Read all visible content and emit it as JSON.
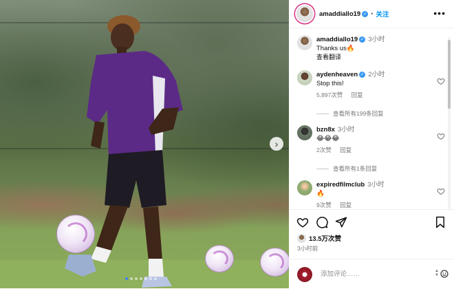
{
  "post": {
    "author": "amaddiallo19",
    "follow_label": "关注",
    "more_icon": "more-horizontal-icon",
    "caption_text": "Thanks us🔥",
    "caption_time": "3小时",
    "translate_label": "查看翻译",
    "likes_label": "13.5万次赞",
    "time_ago": "3小时前"
  },
  "comments": [
    {
      "user": "aydenheaven",
      "verified": true,
      "time": "2小时",
      "text": "Stop this!",
      "likes": "5,897次赞",
      "reply_label": "回复",
      "view_replies": "查看所有199条回复"
    },
    {
      "user": "bzn8x",
      "verified": false,
      "time": "3小时",
      "text": "😂😂😂",
      "likes": "2次赞",
      "reply_label": "回复",
      "view_replies": "查看所有1条回复"
    },
    {
      "user": "expiredfilmclub",
      "verified": false,
      "time": "3小时",
      "text": "🔥",
      "likes": "9次赞",
      "reply_label": "回复"
    }
  ],
  "composer": {
    "placeholder": "添加评论……"
  },
  "colors": {
    "accent_blue": "#0095f6",
    "verified_blue": "#3897f0",
    "muted_text": "#777777",
    "jersey_purple": "#5b2a86"
  }
}
